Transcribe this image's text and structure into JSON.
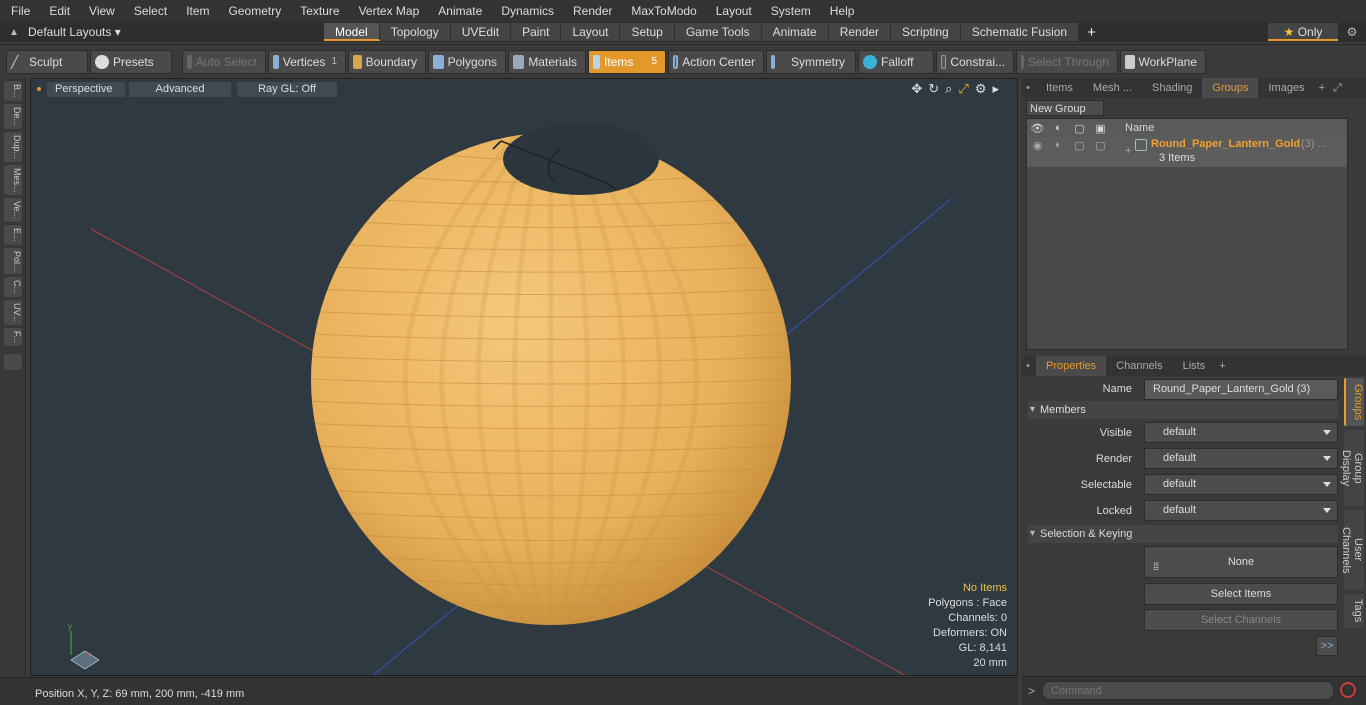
{
  "menu": [
    "File",
    "Edit",
    "View",
    "Select",
    "Item",
    "Geometry",
    "Texture",
    "Vertex Map",
    "Animate",
    "Dynamics",
    "Render",
    "MaxToModo",
    "Layout",
    "System",
    "Help"
  ],
  "layout_selector": "Default Layouts",
  "layout_tabs": [
    "Model",
    "Topology",
    "UVEdit",
    "Paint",
    "Layout",
    "Setup",
    "Game Tools",
    "Animate",
    "Render",
    "Scripting",
    "Schematic Fusion"
  ],
  "layout_active": "Model",
  "only_label": "Only",
  "toolbar": {
    "sculpt": "Sculpt",
    "presets": "Presets",
    "auto_select": "Auto Select",
    "vertices": "Vertices",
    "vertices_count": "1",
    "boundary": "Boundary",
    "polygons": "Polygons",
    "materials": "Materials",
    "items": "Items",
    "items_count": "5",
    "action_center": "Action Center",
    "symmetry": "Symmetry",
    "falloff": "Falloff",
    "constraints": "Constrai...",
    "select_through": "Select Through",
    "workplane": "WorkPlane"
  },
  "left_tabs": [
    "B...",
    "De...",
    "Dup...",
    "Mes...",
    "Ve...",
    "E...",
    "Pol...",
    "C...",
    "UV...",
    "F..."
  ],
  "viewport": {
    "perspective": "Perspective",
    "advanced": "Advanced",
    "raygl": "Ray GL: Off",
    "stats": {
      "items": "No Items",
      "polygons": "Polygons : Face",
      "channels": "Channels: 0",
      "deformers": "Deformers: ON",
      "gl": "GL: 8,141",
      "scale": "20 mm"
    }
  },
  "status": {
    "position": "Position X, Y, Z:  69 mm, 200 mm, -419 mm"
  },
  "scene_tabs": [
    "Items",
    "Mesh ...",
    "Shading",
    "Groups",
    "Images"
  ],
  "scene_active": "Groups",
  "new_group": "New Group",
  "col_name": "Name",
  "group": {
    "name": "Round_Paper_Lantern_Gold",
    "count": "(3) ...",
    "items": "3 Items"
  },
  "prop_tabs": [
    "Properties",
    "Channels",
    "Lists"
  ],
  "props": {
    "name_label": "Name",
    "name_value": "Round_Paper_Lantern_Gold (3)",
    "members": "Members",
    "visible_label": "Visible",
    "visible": "default",
    "render_label": "Render",
    "render": "default",
    "selectable_label": "Selectable",
    "selectable": "default",
    "locked_label": "Locked",
    "locked": "default",
    "sel_keying": "Selection & Keying",
    "none": "None",
    "select_items": "Select Items",
    "select_channels": "Select Channels",
    "more": ">>"
  },
  "right_vtabs": [
    "Groups",
    "Group Display",
    "User Channels",
    "Tags"
  ],
  "command_placeholder": "Command",
  "colors": {
    "accent": "#e89a2c",
    "lantern": "#f2b85c",
    "viewport_bg": "#2f3941"
  }
}
